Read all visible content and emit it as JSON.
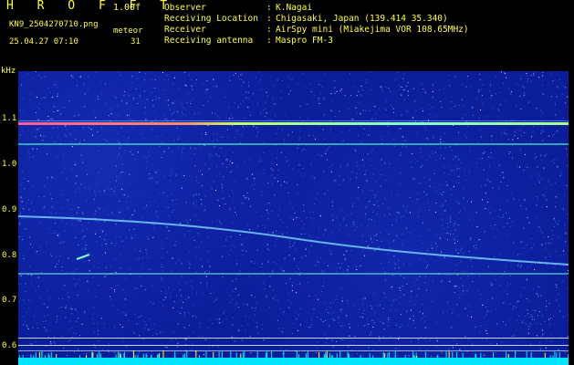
{
  "header": {
    "app_title": "H R O F F T",
    "version": "1.00f",
    "filename": "KN9_2504270710.png",
    "timestamp": "25.04.27 07:10",
    "meteor_label": "meteor",
    "meteor_count": "31"
  },
  "info": [
    {
      "key": "Observer",
      "value": "K.Nagai"
    },
    {
      "key": "Receiving Location",
      "value": "Chigasaki, Japan (139.414 35.340)"
    },
    {
      "key": "Receiver",
      "value": "AirSpy mini (Miakejima VOR 108.65MHz)"
    },
    {
      "key": "Receiving antenna",
      "value": "Maspro FM-3"
    }
  ],
  "spectrogram": {
    "y_unit": "kHz",
    "y_ticks": [
      "1.1",
      "1.0",
      "0.9",
      "0.8",
      "0.7",
      "0.6"
    ],
    "x_ticks": [
      "0711",
      "0712",
      "0713",
      "0714",
      "0715",
      "0716",
      "0717",
      "0718",
      "0719",
      "0720"
    ],
    "colors": {
      "background": "#0a1d9a",
      "noise": "#6fa8ff",
      "carrier": "#7fffd4",
      "labels": "#ffff33"
    }
  }
}
